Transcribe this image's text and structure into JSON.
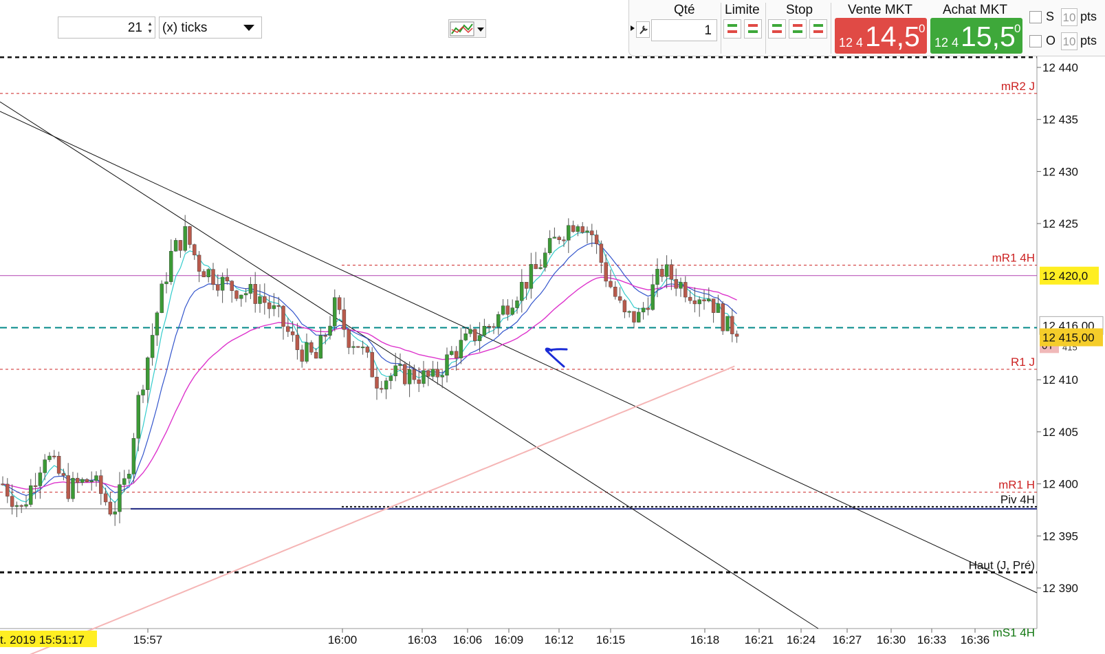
{
  "toolbar": {
    "ticks_value": "21",
    "units_label": "(x) ticks",
    "indicator_icon": "chart-indicators-icon"
  },
  "order_panel": {
    "wrench_icon": "wrench-icon",
    "qty_label": "Qté",
    "qty_value": "1",
    "limit_label": "Limite",
    "stop_label": "Stop",
    "sell": {
      "label": "Vente MKT",
      "prefix": "12 4",
      "main": "14,5",
      "sup": "0",
      "color": "#e04a45"
    },
    "buy": {
      "label": "Achat MKT",
      "prefix": "12 4",
      "main": "15,5",
      "sup": "0",
      "color": "#3ea83a"
    },
    "s_label": "S",
    "o_label": "O",
    "s_pts": "10",
    "o_pts": "10",
    "pts_label": "pts"
  },
  "chart": {
    "price_axis": [
      "12 440",
      "12 435",
      "12 430",
      "12 425",
      "12 420,0",
      "12 416,00",
      "12 415,00",
      "12 410",
      "12 405",
      "12 400",
      "12 395",
      "12 390"
    ],
    "time_axis": [
      "t. 2019 15:51:17",
      "15:57",
      "16:00",
      "16:03",
      "16:06",
      "16:09",
      "16:12",
      "16:15",
      "16:18",
      "16:21",
      "16:24",
      "16:27",
      "16:30",
      "16:33",
      "16:36"
    ],
    "overlay_ot": "0T",
    "overlay_ot_value": "415",
    "levels": [
      {
        "label": "mR2 J",
        "price": 12437.5,
        "color": "#cc2222"
      },
      {
        "label": "mR1 4H",
        "price": 12421.0,
        "color": "#cc2222"
      },
      {
        "label": "R1 J",
        "price": 12411.0,
        "color": "#cc2222"
      },
      {
        "label": "mR1 H",
        "price": 12399.2,
        "color": "#cc2222"
      },
      {
        "label": "Piv 4H",
        "price": 12397.8,
        "color": "#111111"
      },
      {
        "label": "Haut (J, Pré)",
        "price": 12391.5,
        "color": "#111111"
      },
      {
        "label": "mS1 4H",
        "price": 12385.0,
        "color": "#117711"
      }
    ],
    "colors": {
      "up": "#3c9a36",
      "down": "#b85a4c",
      "ema_fast": "#33cccc",
      "ema_mid": "#3355cc",
      "ema_slow": "#dd33cc",
      "ema_long": "#f5b5b5",
      "last_price": "#008888",
      "highlight": "#ffee22"
    }
  }
}
